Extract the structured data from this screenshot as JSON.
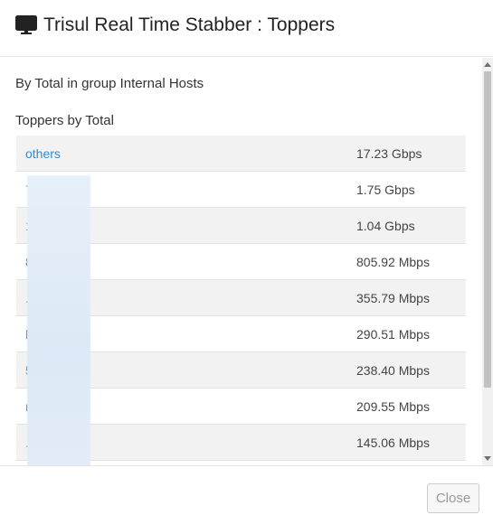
{
  "modal": {
    "title": "Trisul Real Time Stabber : Toppers",
    "title_icon": "monitor-icon"
  },
  "body": {
    "subtitle": "By Total in group Internal Hosts",
    "section_title": "Toppers by Total",
    "rows": [
      {
        "key": "others",
        "value": "17.23 Gbps"
      },
      {
        "key": "7.220",
        "value": "1.75 Gbps"
      },
      {
        "key": "130",
        "value": "1.04 Gbps"
      },
      {
        "key": "8.190",
        "value": "805.92 Mbps"
      },
      {
        "key": ".4.47",
        "value": "355.79 Mbps"
      },
      {
        "key": "le.com",
        "value": "290.51 Mbps"
      },
      {
        "key": "51",
        "value": "238.40 Mbps"
      },
      {
        "key": "n",
        "value": "209.55 Mbps"
      },
      {
        "key": ".73",
        "value": "145.06 Mbps"
      },
      {
        "key": "",
        "value": ""
      }
    ]
  },
  "footer": {
    "close_label": "Close"
  },
  "colors": {
    "link": "#2a8fd6",
    "row_stripe": "#f2f2f2"
  }
}
